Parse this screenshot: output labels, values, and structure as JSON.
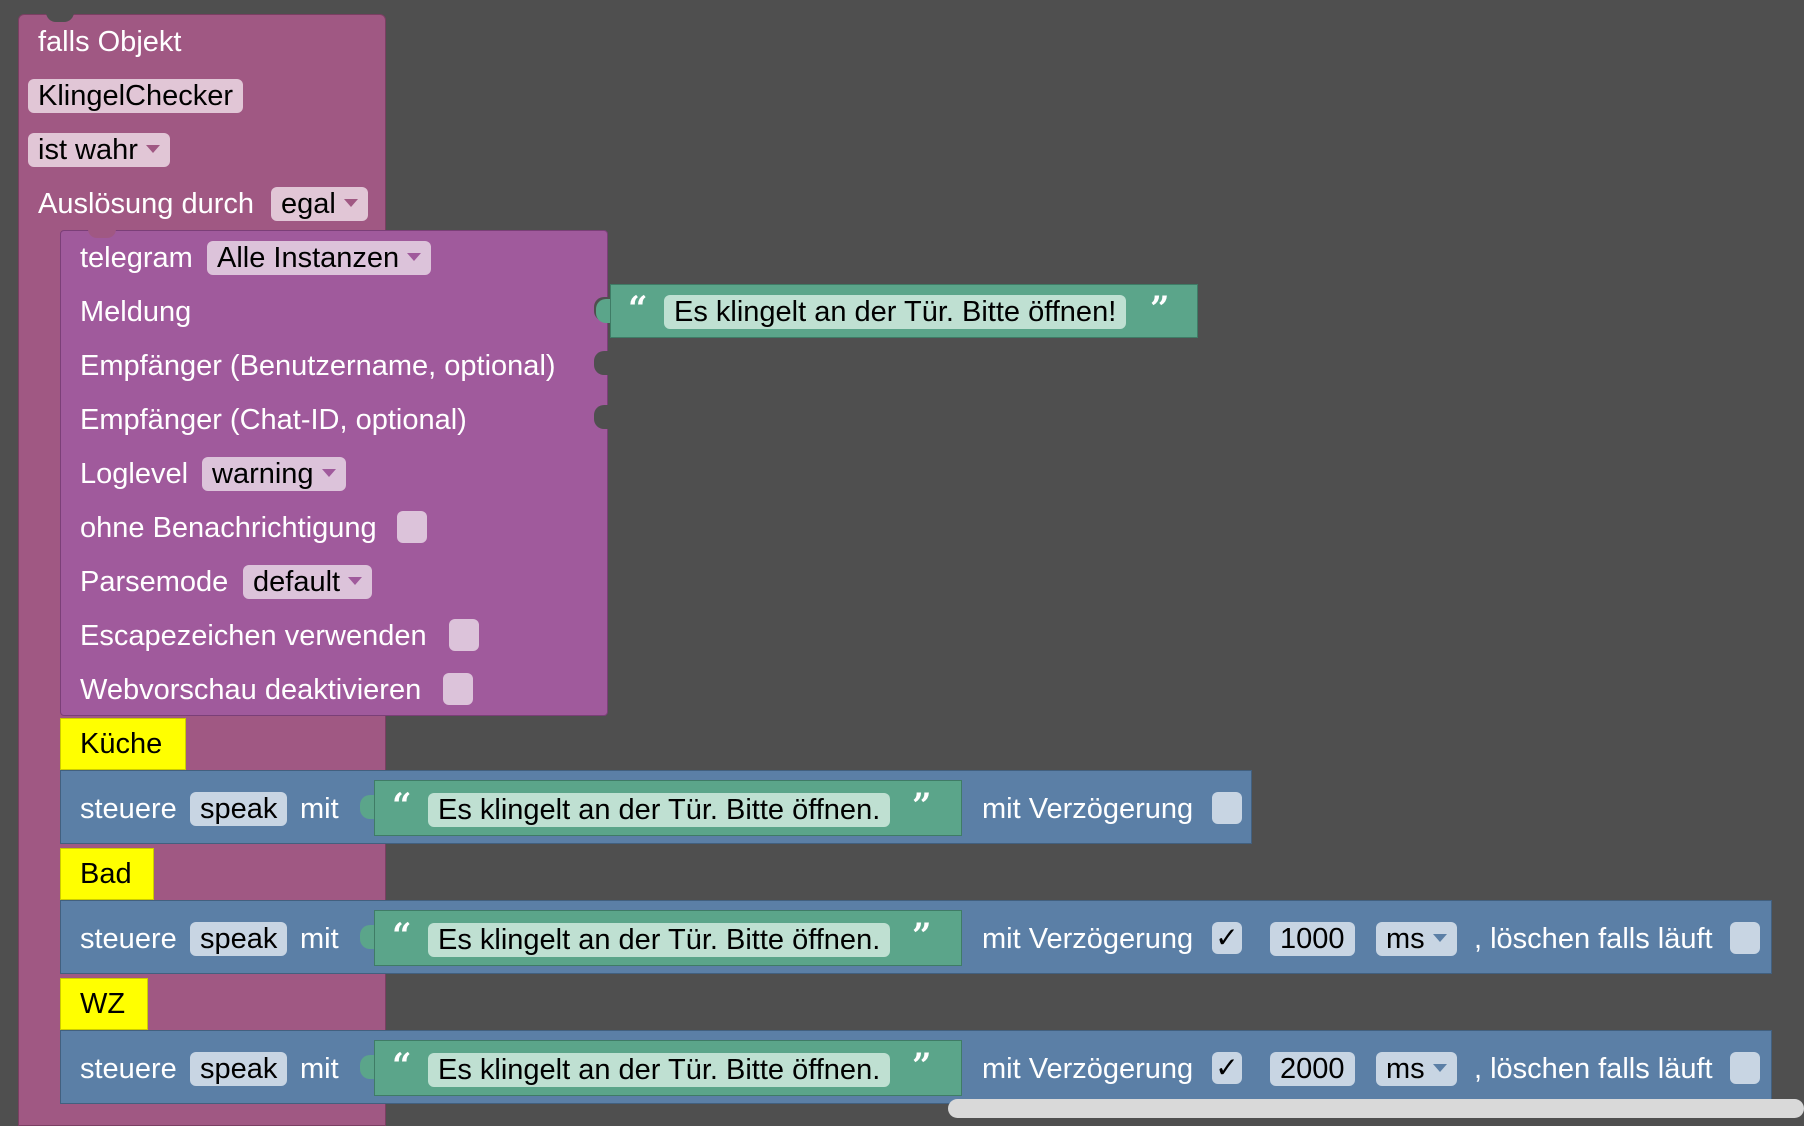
{
  "trigger": {
    "header": "falls Objekt",
    "object": "KlingelChecker",
    "condition": "ist wahr",
    "trigger_label": "Auslösung durch",
    "trigger_value": "egal"
  },
  "telegram": {
    "label": "telegram",
    "instance": "Alle Instanzen",
    "message_label": "Meldung",
    "message_text": "Es klingelt an der Tür. Bitte öffnen!",
    "recipient_user_label": "Empfänger (Benutzername, optional)",
    "recipient_chat_label": "Empfänger (Chat-ID, optional)",
    "loglevel_label": "Loglevel",
    "loglevel": "warning",
    "silent_label": "ohne Benachrichtigung",
    "parsemode_label": "Parsemode",
    "parsemode": "default",
    "escape_label": "Escapezeichen verwenden",
    "webpreview_label": "Webvorschau deaktivieren"
  },
  "speak_actions": [
    {
      "comment": "Küche",
      "verb": "steuere",
      "target": "speak",
      "with": "mit",
      "text": "Es klingelt an der Tür. Bitte öffnen.",
      "delay_label": "mit Verzögerung",
      "delay_checked": false
    },
    {
      "comment": "Bad",
      "verb": "steuere",
      "target": "speak",
      "with": "mit",
      "text": "Es klingelt an der Tür. Bitte öffnen.",
      "delay_label": "mit Verzögerung",
      "delay_checked": true,
      "delay_value": "1000",
      "unit": "ms",
      "clear_label": ", löschen falls läuft"
    },
    {
      "comment": "WZ",
      "verb": "steuere",
      "target": "speak",
      "with": "mit",
      "text": "Es klingelt an der Tür. Bitte öffnen.",
      "delay_label": "mit Verzögerung",
      "delay_checked": true,
      "delay_value": "2000",
      "unit": "ms",
      "clear_label": ", löschen falls läuft"
    }
  ],
  "symbols": {
    "open_quote": "“",
    "close_quote": "”",
    "checkmark": "✓"
  },
  "colors": {
    "workspace": "#4f4f4f",
    "trigger_block": "#a05883",
    "telegram_block": "#a05a9c",
    "speak_block": "#5b7fa6",
    "text_block": "#5ba58a",
    "comment_block": "#ffff00"
  }
}
